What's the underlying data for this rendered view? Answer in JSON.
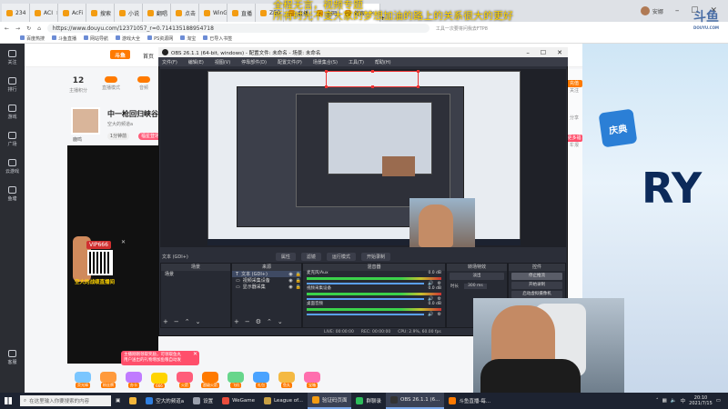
{
  "browser": {
    "tabs": [
      {
        "label": "234"
      },
      {
        "label": "ACI"
      },
      {
        "label": "AcFi"
      },
      {
        "label": "搜索"
      },
      {
        "label": "小说"
      },
      {
        "label": "翻唱"
      },
      {
        "label": "点击"
      },
      {
        "label": "WinGame"
      },
      {
        "label": "直播"
      },
      {
        "label": "ZEO"
      },
      {
        "label": "直播"
      },
      {
        "label": "全网"
      },
      {
        "label": "搜索",
        "active": true
      }
    ],
    "user_label": "安娜",
    "address": "https://www.douyu.com/12371057_r=0.714135188954718",
    "address_extra": "工具一次要将问我去FTP8",
    "bookmarks": [
      "百度热搜",
      "斗鱼直播",
      "网站导航",
      "游戏大全",
      "PS资源网",
      "淘宝",
      "已导入书签"
    ]
  },
  "overlay_title": [
    "全程无言，视频专题",
    "所有时光不变大家的梦想加油的路上的关系很大的更好"
  ],
  "douyu": {
    "nav": [
      "关注",
      "排行",
      "游戏",
      "广场",
      "云游戏",
      "鱼塘",
      "客服"
    ],
    "logo": "斗鱼",
    "home": "首页",
    "stats": [
      {
        "num": "12",
        "label": "主播积分"
      },
      {
        "num": "",
        "label": "直播模式"
      },
      {
        "num": "",
        "label": "音频"
      },
      {
        "num": "",
        "label": "竞技"
      }
    ],
    "anchor_title": "中一枪回归峡谷之",
    "anchor_sub": "空大的频道a",
    "anchor_name": "鹿鸣",
    "anchor_tag1": "1分钟前",
    "anchor_tag2": "福星登场",
    "promo_vip": "VIP666",
    "promo_caption": "空大的战绩直播间",
    "notice_text": "主播刚刚领取奖励，可领取鱼丸\n用户送出的礼物增加鱼粮自动发",
    "gifts": [
      "荧光棒",
      "粉丝牌",
      "办卡",
      "666",
      "火箭",
      "超级火箭",
      "飞机",
      "礼包",
      "鱼丸",
      "宝箱"
    ],
    "rc_badges": {
      "top": "充值",
      "mid": "更多福利"
    },
    "right_items": [
      "关注",
      "分享",
      "举报",
      "",
      "",
      ""
    ]
  },
  "banner": {
    "logo": "斗鱼",
    "logo_sub": "DOUYU.COM",
    "big_text": "RY",
    "chibi": "庆典"
  },
  "obs": {
    "title": "OBS 26.1.1 (64-bit, windows) - 配置文件: 未命名 - 场景: 未命名",
    "menu": [
      "文件(F)",
      "编辑(E)",
      "视图(V)",
      "停靠部件(D)",
      "配置文件(P)",
      "场景集合(S)",
      "工具(T)",
      "帮助(H)"
    ],
    "source_bar": {
      "current": "文本 (GDI+)",
      "tabs": [
        "属性",
        "滤镜",
        "运行模式",
        "开始录制"
      ]
    },
    "scenes_header": "场景",
    "scenes": [
      "场景"
    ],
    "sources_header": "来源",
    "sources": [
      "文本 (GDI+)",
      "视频采集设备",
      "显示器采集"
    ],
    "mixer_header": "混音器",
    "mixer": [
      {
        "label": "麦克风/Aux",
        "value": "0.0 dB"
      },
      {
        "label": "视频采集设备",
        "value": "0.0 dB"
      },
      {
        "label": "桌面音频",
        "value": "0.0 dB"
      }
    ],
    "transitions_header": "转场特效",
    "transition_value": "淡出",
    "duration_label": "时长",
    "duration_value": "300 ms",
    "controls_header": "控件",
    "controls": [
      "停止推流",
      "开始录制",
      "启动虚拟摄像机"
    ],
    "status": [
      "LIVE: 00:00:00",
      "REC: 00:00:00",
      "CPU: 2.9%, 60.00 fps"
    ]
  },
  "taskbar": {
    "search_placeholder": "在这里输入你要搜索的内容",
    "apps": [
      {
        "label": "",
        "color": "#f3b63a"
      },
      {
        "label": "空大的频道a",
        "color": "#2f7fe0"
      },
      {
        "label": "设置",
        "color": "#9aa0ad"
      },
      {
        "label": "WeGame",
        "color": "#e94c3c"
      },
      {
        "label": "League of...",
        "color": "#c8a043"
      },
      {
        "label": "验证码页面",
        "color": "#f39c12",
        "active": true
      },
      {
        "label": "群聊录",
        "color": "#2ebd5a"
      },
      {
        "label": "OBS 26.1.1 (6...",
        "color": "#333",
        "active": true
      },
      {
        "label": "斗鱼直播-每...",
        "color": "#ff7a00"
      }
    ],
    "time": "20:10",
    "date": "2021/7/15"
  }
}
